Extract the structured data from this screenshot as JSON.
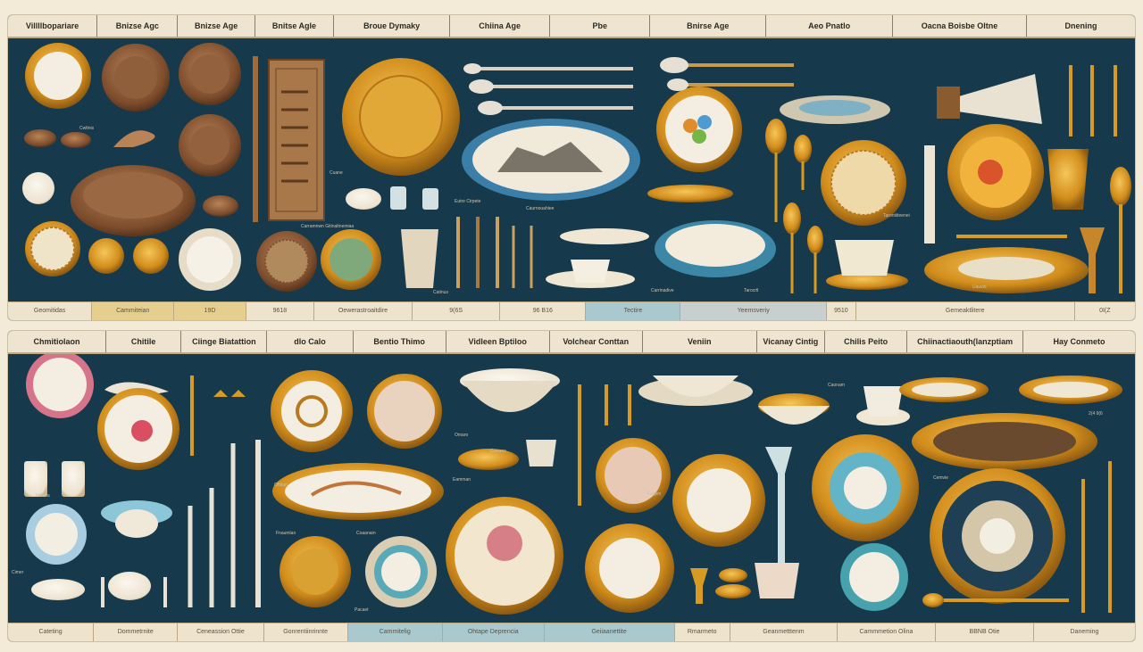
{
  "top_panel": {
    "headers": [
      "Villllbopariare",
      "Bnizse Agc",
      "Bnizse Age",
      "Bnitse Agle",
      "Broue Dymaky",
      "Chiina Age",
      "Pbe",
      "Bnirse Age",
      "Aeo Pnatlo",
      "Oacna Boisbe Oltne",
      "Dnening"
    ],
    "footer": [
      "Geomitidas",
      "Cammiteian",
      "19D",
      "9618",
      "Oewerastroaitdire",
      "9(6S",
      "96 B16",
      "Tectire",
      "Yeemsveriy",
      "9510",
      "Gemeaktlitere",
      "0I(Z"
    ],
    "small_labels": [
      "Cwltnis",
      "Cuane",
      "Eutre Cirpete",
      "Carramnwn Gitinaltnemiaa",
      "Caurnouahiee",
      "Carrinadive",
      "Tarocrtl",
      "Tarontiiteenei",
      "Uauvio",
      "Catinus"
    ]
  },
  "bottom_panel": {
    "headers": [
      "Chmitiolaon",
      "Chitile",
      "Ciinge Biatattion",
      "dlo Calo",
      "Bentio Thimo",
      "Vidleen Bptiloo",
      "Volchear Conttan",
      "Veniin",
      "Vicanay Cintig",
      "Chilis Peito",
      "Chiinactiaouth(lanzptiam",
      "Hay Conmeto"
    ],
    "footer": [
      "Cateting",
      "Dommetrnite",
      "Ceneassion Ottie",
      "Gonrentiinrinnte",
      "Cammitelig",
      "Ohtape Deprencia",
      "Geiiaanettite",
      "Rmarmeto",
      "Geanmetttenm",
      "Cammmetion Olina",
      "BBNB Otie",
      "Daneming"
    ],
    "small_labels": [
      "Cimer",
      "Ttitmoa",
      "Ofttian",
      "Fnaumlan",
      "Coaanam",
      "Omaro",
      "Ganueo",
      "Eamman",
      "Pacaet",
      "Faigen",
      "Caonam",
      "Cemvie",
      "2(4 9(6"
    ]
  },
  "colors": {
    "panel_bg": "#163a4c",
    "page_bg": "#f3ead8",
    "gold": "#d79a23",
    "porcelain": "#f4eee2",
    "bronze": "#8a5a34"
  }
}
